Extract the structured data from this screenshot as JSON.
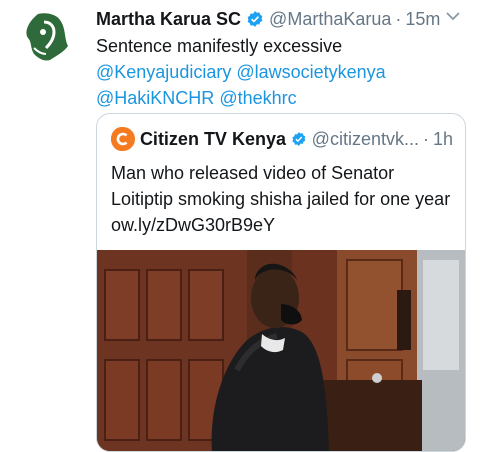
{
  "tweet": {
    "author_name": "Martha Karua SC",
    "author_handle": "@MarthaKarua",
    "separator": "·",
    "time": "15m",
    "text_line1": "Sentence manifestly excessive",
    "mentions_line2": [
      "@Kenyajudiciary",
      "@lawsocietykenya"
    ],
    "mentions_line3": [
      "@HakiKNCHR",
      "@thekhrc"
    ]
  },
  "quoted": {
    "author_name": "Citizen TV Kenya",
    "author_handle": "@citizentvk...",
    "separator": "·",
    "time": "1h",
    "text_line1": "Man who released video of Senator",
    "text_line2": "Loitiptip smoking shisha jailed for one year",
    "link": "ow.ly/zDwG30rB9eY"
  },
  "colors": {
    "link": "#1b95e0",
    "muted": "#657786",
    "verified": "#1da1f2",
    "brand_avatar": "#2f6b3a",
    "citizen_logo": "#f47b20"
  },
  "icons": [
    "kenya-map-logo-icon",
    "verified-badge-icon",
    "chevron-down-icon",
    "citizen-logo-icon"
  ]
}
